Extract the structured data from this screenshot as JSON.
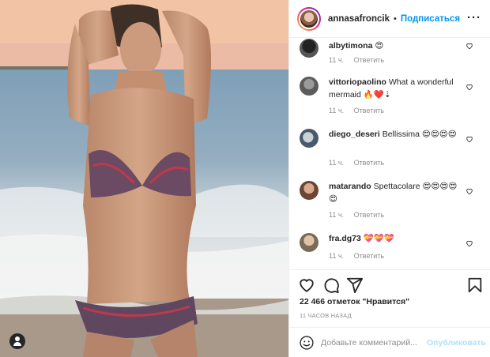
{
  "post": {
    "username": "annasafroncik",
    "dot": "•",
    "follow_label": "Подписаться",
    "more_label": "···",
    "likes_text": "22 466 отметок \"Нравится\"",
    "time_text": "11 ЧАСОВ НАЗАД",
    "comment_placeholder": "Добавьте комментарий...",
    "publish_label": "Опубликовать"
  },
  "comments": [
    {
      "user": "albytimona",
      "text": "😍",
      "time": "11 ч.",
      "reply": "Ответить"
    },
    {
      "user": "vittoriopaolino",
      "text": "What a wonderful mermaid 🔥❤️⇣",
      "time": "11 ч.",
      "reply": "Ответить"
    },
    {
      "user": "diego_deseri",
      "text": "Bellissima 😍😍😍😍",
      "time": "11 ч.",
      "reply": "Ответить"
    },
    {
      "user": "matarando",
      "text": "Spettacolare 😍😍😍😍😍",
      "time": "11 ч.",
      "reply": "Ответить"
    },
    {
      "user": "fra.dg73",
      "text": "💝💝💝",
      "time": "11 ч.",
      "reply": "Ответить"
    }
  ],
  "icons": {
    "like": "heart-icon",
    "comment": "comment-icon",
    "share": "send-icon",
    "save": "bookmark-icon",
    "emoji": "smile-icon",
    "tag": "user-tag-icon"
  },
  "colors": {
    "accent": "#0095f6",
    "publish_disabled": "#b2dffc",
    "secondary_text": "#8e8e8e"
  }
}
